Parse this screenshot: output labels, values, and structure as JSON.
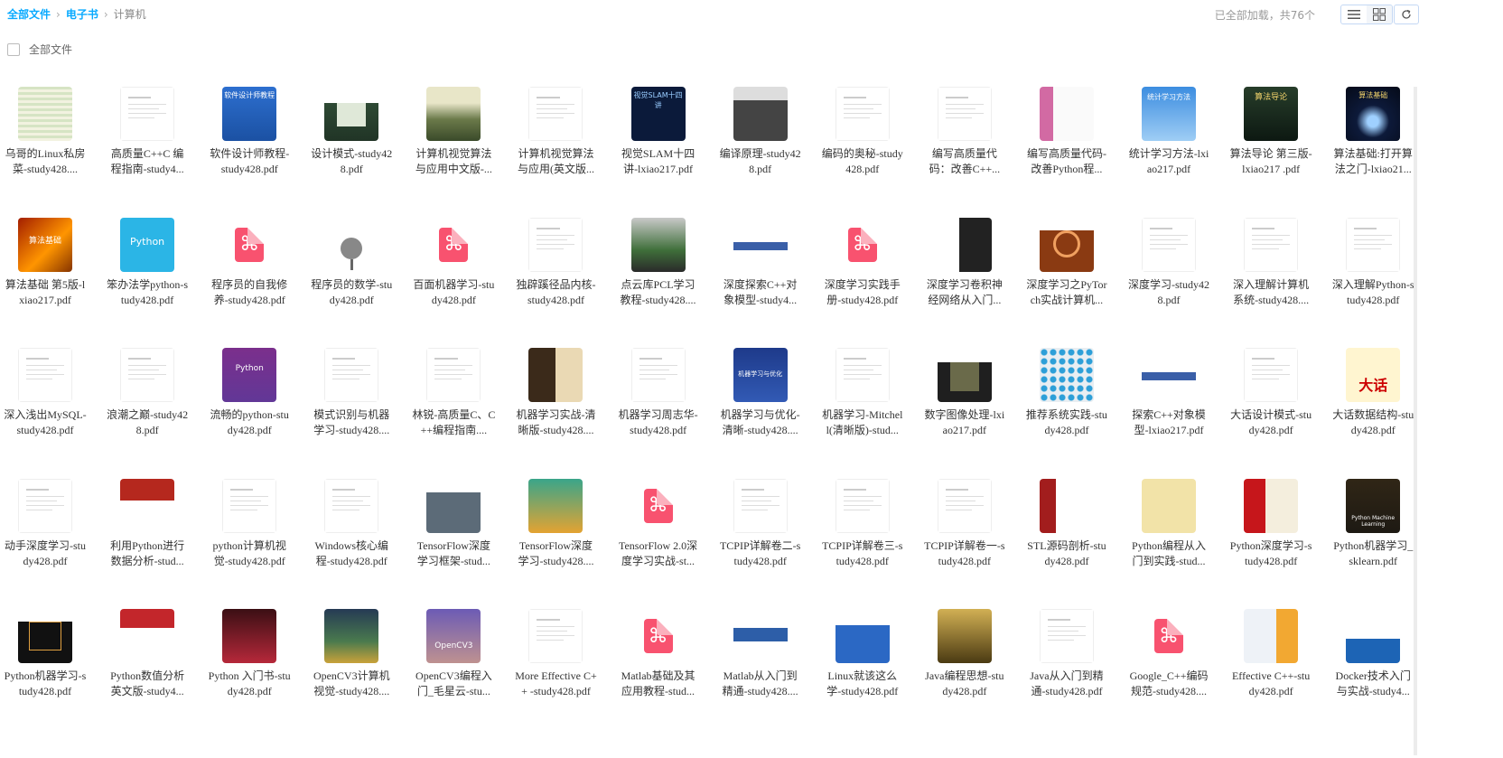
{
  "breadcrumb": {
    "root": "全部文件",
    "parent": "电子书",
    "current": "计算机",
    "sep": "›"
  },
  "status_text": "已全部加载，共76个",
  "select_all_label": "全部文件",
  "view_buttons": [
    {
      "icon": "list-view-icon",
      "active": false
    },
    {
      "icon": "grid-view-icon",
      "active": true
    }
  ],
  "refresh_icon": "refresh-icon",
  "files": [
    {
      "name": "乌哥的Linux私房菜-study428....",
      "thumb": "sheet"
    },
    {
      "name": "高质量C++C 编程指南-study4...",
      "thumb": "doc"
    },
    {
      "name": "软件设计师教程-study428.pdf",
      "thumb": "blue"
    },
    {
      "name": "设计模式-study428.pdf",
      "thumb": "greenbook"
    },
    {
      "name": "计算机视觉算法与应用中文版-...",
      "thumb": "painting"
    },
    {
      "name": "计算机视觉算法与应用(英文版...",
      "thumb": "doc"
    },
    {
      "name": "视觉SLAM十四讲-lxiao217.pdf",
      "thumb": "navy"
    },
    {
      "name": "编译原理-study428.pdf",
      "thumb": "gray"
    },
    {
      "name": "编码的奥秘-study428.pdf",
      "thumb": "doc"
    },
    {
      "name": "编写高质量代码：改善C++...",
      "thumb": "doc"
    },
    {
      "name": "编写高质量代码-改善Python程...",
      "thumb": "pink"
    },
    {
      "name": "统计学习方法-lxiao217.pdf",
      "thumb": "sky"
    },
    {
      "name": "算法导论 第三版-lxiao217 .pdf",
      "thumb": "darkgreen"
    },
    {
      "name": "算法基础:打开算法之门-lxiao21...",
      "thumb": "night"
    },
    {
      "name": "算法基础 第5版-lxiao217.pdf",
      "thumb": "orange"
    },
    {
      "name": "笨办法学python-study428.pdf",
      "thumb": "cyan"
    },
    {
      "name": "程序员的自我修养-study428.pdf",
      "thumb": "pdf"
    },
    {
      "name": "程序员的数学-study428.pdf",
      "thumb": "tree"
    },
    {
      "name": "百面机器学习-study428.pdf",
      "thumb": "pdf"
    },
    {
      "name": "独辟蹊径品内核-study428.pdf",
      "thumb": "doc"
    },
    {
      "name": "点云库PCL学习教程-study428....",
      "thumb": "pcl"
    },
    {
      "name": "深度探索C++对象模型-study4...",
      "thumb": "cppmodel"
    },
    {
      "name": "深度学习实践手册-study428.pdf",
      "thumb": "pdf"
    },
    {
      "name": "深度学习卷积神经网络从入门...",
      "thumb": "bw"
    },
    {
      "name": "深度学习之PyTorch实战计算机...",
      "thumb": "torch"
    },
    {
      "name": "深度学习-study428.pdf",
      "thumb": "doc"
    },
    {
      "name": "深入理解计算机系统-study428....",
      "thumb": "doc"
    },
    {
      "name": "深入理解Python-study428.pdf",
      "thumb": "doc"
    },
    {
      "name": "深入浅出MySQL-study428.pdf",
      "thumb": "doc"
    },
    {
      "name": "浪潮之巅-study428.pdf",
      "thumb": "doc"
    },
    {
      "name": "流畅的python-study428.pdf",
      "thumb": "purple"
    },
    {
      "name": "模式识别与机器学习-study428....",
      "thumb": "doc"
    },
    {
      "name": "林锐-高质量C、C++编程指南....",
      "thumb": "doc"
    },
    {
      "name": "机器学习实战-清晰版-study428....",
      "thumb": "mlia"
    },
    {
      "name": "机器学习周志华-study428.pdf",
      "thumb": "doc"
    },
    {
      "name": "机器学习与优化-清晰-study428....",
      "thumb": "mlopt"
    },
    {
      "name": "机器学习-Mitchell(清晰版)-stud...",
      "thumb": "doc"
    },
    {
      "name": "数字图像处理-lxiao217.pdf",
      "thumb": "dip"
    },
    {
      "name": "推荐系统实践-study428.pdf",
      "thumb": "dots"
    },
    {
      "name": "探索C++对象模型-lxiao217.pdf",
      "thumb": "cppmodel"
    },
    {
      "name": "大话设计模式-study428.pdf",
      "thumb": "doc"
    },
    {
      "name": "大话数据结构-study428.pdf",
      "thumb": "dahua"
    },
    {
      "name": "动手深度学习-study428.pdf",
      "thumb": "doc"
    },
    {
      "name": "利用Python进行数据分析-stud...",
      "thumb": "pydata"
    },
    {
      "name": "python计算机视觉-study428.pdf",
      "thumb": "doc"
    },
    {
      "name": "Windows核心编程-study428.pdf",
      "thumb": "doc"
    },
    {
      "name": "TensorFlow深度学习框架-stud...",
      "thumb": "tf1"
    },
    {
      "name": "TensorFlow深度学习-study428....",
      "thumb": "tf2"
    },
    {
      "name": "TensorFlow 2.0深度学习实战-st...",
      "thumb": "pdf"
    },
    {
      "name": "TCPIP详解卷二-study428.pdf",
      "thumb": "doc"
    },
    {
      "name": "TCPIP详解卷三-study428.pdf",
      "thumb": "doc"
    },
    {
      "name": "TCPIP详解卷一-study428.pdf",
      "thumb": "doc"
    },
    {
      "name": "STL源码剖析-study428.pdf",
      "thumb": "stl"
    },
    {
      "name": "Python编程从入门到实践-stud...",
      "thumb": "pycrash"
    },
    {
      "name": "Python深度学习-study428.pdf",
      "thumb": "pydl"
    },
    {
      "name": "Python机器学习_sklearn.pdf",
      "thumb": "pyml"
    },
    {
      "name": "Python机器学习-study428.pdf",
      "thumb": "pyml2"
    },
    {
      "name": "Python数值分析英文版-study4...",
      "thumb": "pyda"
    },
    {
      "name": "Python 入门书-study428.pdf",
      "thumb": "magic"
    },
    {
      "name": "OpenCV3计算机视觉-study428....",
      "thumb": "opencvbook"
    },
    {
      "name": "OpenCV3编程入门_毛星云-stu...",
      "thumb": "opencv"
    },
    {
      "name": "More Effective C++ -study428.pdf",
      "thumb": "doc"
    },
    {
      "name": "Matlab基础及其应用教程-stud...",
      "thumb": "pdf"
    },
    {
      "name": "Matlab从入门到精通-study428....",
      "thumb": "matlab"
    },
    {
      "name": "Linux就该这么学-study428.pdf",
      "thumb": "linux"
    },
    {
      "name": "Java编程思想-study428.pdf",
      "thumb": "java"
    },
    {
      "name": "Java从入门到精通-study428.pdf",
      "thumb": "doc"
    },
    {
      "name": "Google_C++编码规范-study428....",
      "thumb": "pdf"
    },
    {
      "name": "Effective C++-study428.pdf",
      "thumb": "effc"
    },
    {
      "name": "Docker技术入门与实战-study4...",
      "thumb": "docker"
    }
  ]
}
